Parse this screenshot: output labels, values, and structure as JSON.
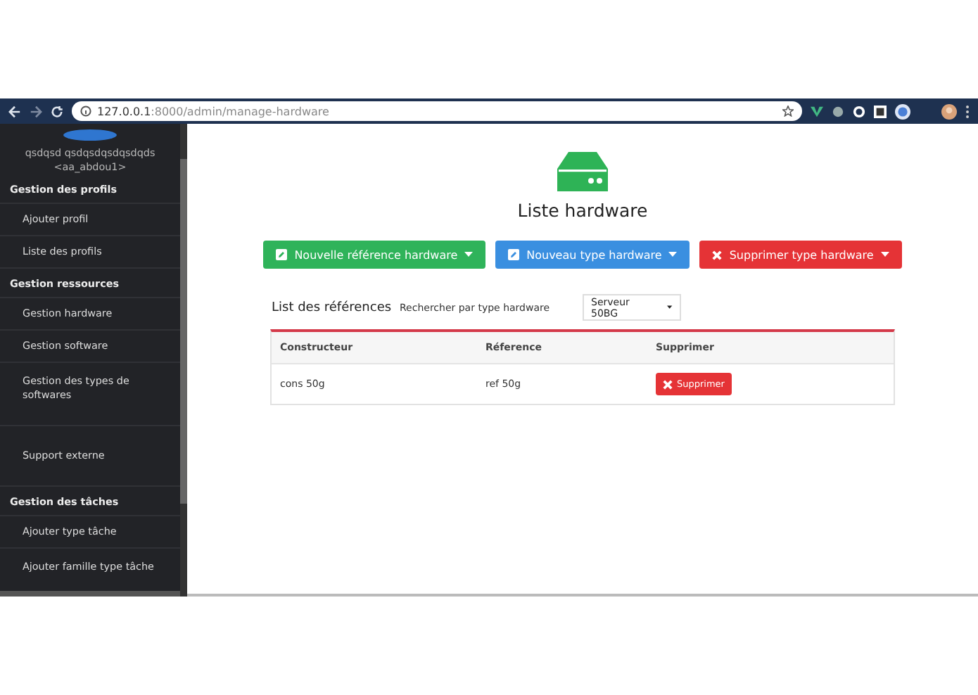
{
  "browser": {
    "url_host": "127.0.0.1",
    "url_rest": ":8000/admin/manage-hardware"
  },
  "sidebar": {
    "user_name": "qsdqsd qsdqsdqsdqsdqds",
    "user_login": "<aa_abdou1>",
    "sections": [
      {
        "title": "Gestion des profils",
        "items": [
          "Ajouter profil",
          "Liste des profils"
        ]
      },
      {
        "title": "Gestion ressources",
        "items": [
          "Gestion hardware",
          "Gestion software",
          "Gestion des types de softwares"
        ]
      },
      {
        "items": [
          "Support externe"
        ]
      },
      {
        "title": "Gestion des tâches",
        "items": [
          "Ajouter type tâche",
          "Ajouter famille type tâche"
        ]
      }
    ]
  },
  "main": {
    "title": "Liste hardware",
    "buttons": [
      {
        "label": "Nouvelle référence hardware",
        "kind": "edit",
        "color": "#2fb35a"
      },
      {
        "label": "Nouveau type hardware",
        "kind": "edit",
        "color": "#3a8fe0"
      },
      {
        "label": "Supprimer type hardware",
        "kind": "delete",
        "color": "#e53336"
      }
    ],
    "list_heading": "List des références",
    "filter_label": "Rechercher par type hardware",
    "filter_value": "Serveur 50BG",
    "table": {
      "columns": [
        "Constructeur",
        "Réference",
        "Supprimer"
      ],
      "rows": [
        {
          "constructeur": "cons 50g",
          "reference": "ref 50g",
          "action": "Supprimer"
        }
      ]
    }
  }
}
